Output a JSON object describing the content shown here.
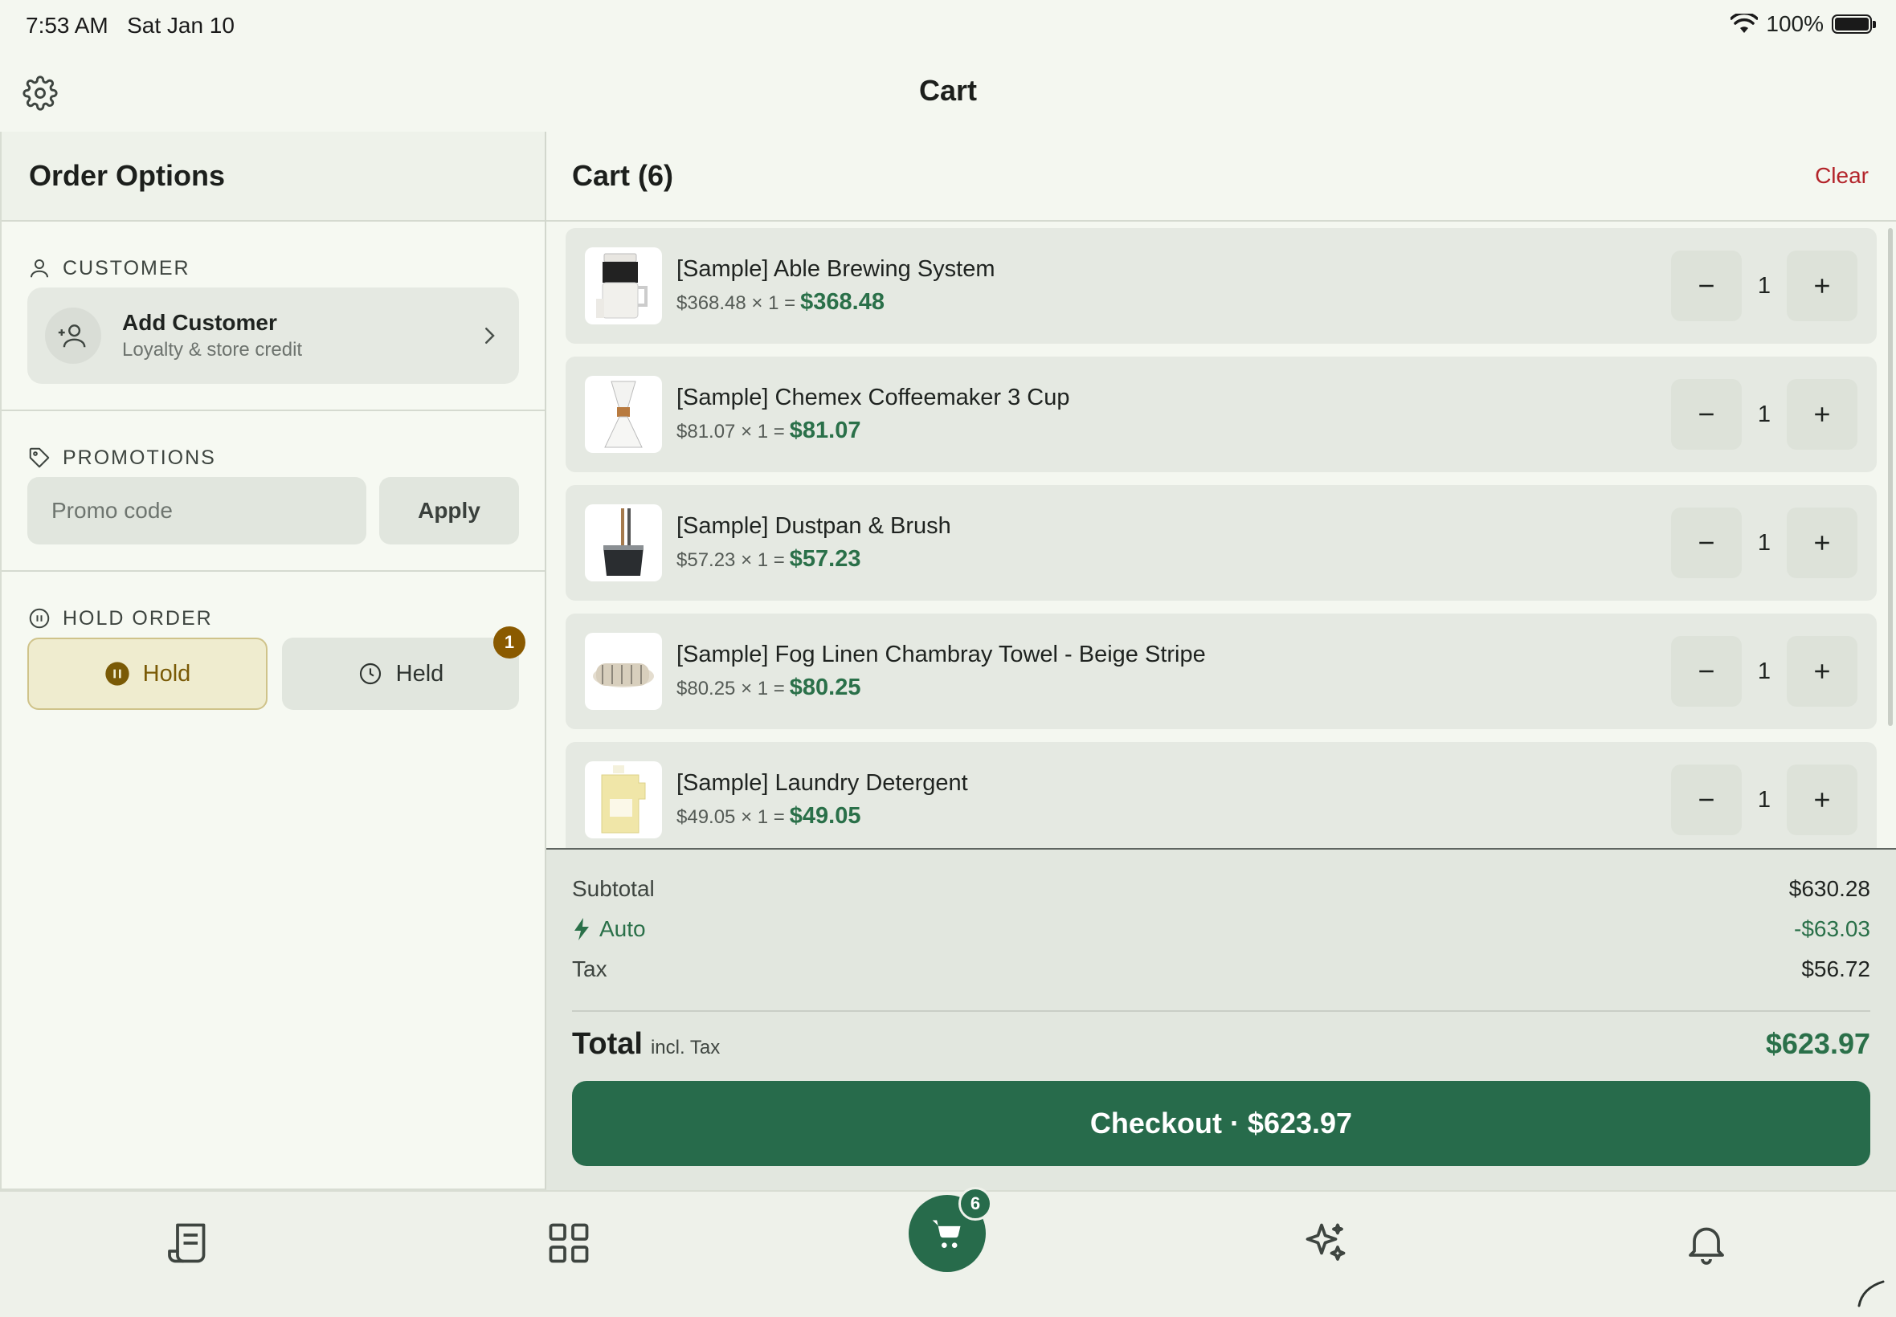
{
  "status_bar": {
    "time": "7:53 AM",
    "date": "Sat Jan 10",
    "battery": "100%"
  },
  "nav": {
    "title": "Cart"
  },
  "order_options": {
    "title": "Order Options",
    "customer": {
      "label": "CUSTOMER",
      "card_title": "Add Customer",
      "card_subtitle": "Loyalty & store credit"
    },
    "promotions": {
      "label": "PROMOTIONS",
      "placeholder": "Promo code",
      "apply_label": "Apply"
    },
    "hold_order": {
      "label": "HOLD ORDER",
      "hold_label": "Hold",
      "held_label": "Held",
      "held_count": "1"
    }
  },
  "cart": {
    "title": "Cart (6)",
    "clear_label": "Clear",
    "items": [
      {
        "name": "[Sample] Able Brewing System",
        "unit": "$368.48 × 1 =",
        "total": "$368.48",
        "qty": "1",
        "thumb": "brewer"
      },
      {
        "name": "[Sample] Chemex Coffeemaker 3 Cup",
        "unit": "$81.07 × 1 =",
        "total": "$81.07",
        "qty": "1",
        "thumb": "chemex"
      },
      {
        "name": "[Sample] Dustpan & Brush",
        "unit": "$57.23 × 1 =",
        "total": "$57.23",
        "qty": "1",
        "thumb": "dustpan"
      },
      {
        "name": "[Sample] Fog Linen Chambray Towel - Beige Stripe",
        "unit": "$80.25 × 1 =",
        "total": "$80.25",
        "qty": "1",
        "thumb": "towel"
      },
      {
        "name": "[Sample] Laundry Detergent",
        "unit": "$49.05 × 1 =",
        "total": "$49.05",
        "qty": "1",
        "thumb": "detergent"
      }
    ]
  },
  "summary": {
    "subtotal_label": "Subtotal",
    "subtotal": "$630.28",
    "auto_label": "Auto",
    "auto_value": "-$63.03",
    "tax_label": "Tax",
    "tax": "$56.72",
    "total_label": "Total",
    "total_note": "incl. Tax",
    "total": "$623.97",
    "checkout_label": "Checkout · $623.97"
  },
  "tabbar": {
    "cart_badge": "6"
  },
  "colors": {
    "accent": "#276b4b",
    "danger": "#b3242a",
    "hold": "#8a5a00"
  }
}
